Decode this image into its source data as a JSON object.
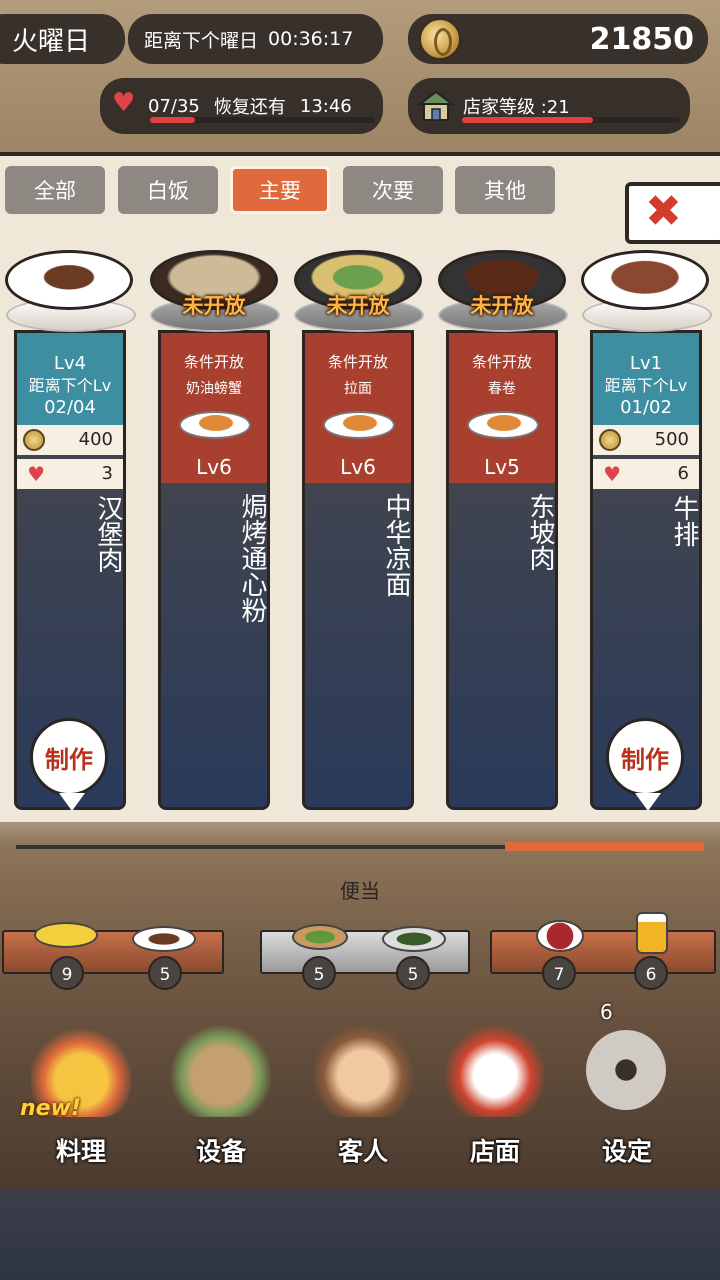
{
  "hud": {
    "day": "火曜日",
    "timer_label": "距离下个曜日",
    "timer_value": "00:36:17",
    "coins": "21850",
    "hearts": "07/35",
    "recover_label": "恢复还有",
    "recover_time": "13:46",
    "hearts_progress": 0.2,
    "shop_label": "店家等级 :21",
    "shop_progress": 0.6
  },
  "tabs": [
    "全部",
    "白饭",
    "主要",
    "次要",
    "其他"
  ],
  "active_tab": "主要",
  "dishes": [
    {
      "name": "汉堡肉",
      "lv": "Lv4",
      "next_label": "距离下个Lv",
      "progress": "02/04",
      "price": "400",
      "hearts": "3",
      "make": "制作"
    },
    {
      "name": "焗烤通心粉",
      "locked": "未开放",
      "cond": "条件开放",
      "cond_dish": "奶油螃蟹",
      "lv": "Lv6"
    },
    {
      "name": "中华凉面",
      "locked": "未开放",
      "cond": "条件开放",
      "cond_dish": "拉面",
      "lv": "Lv6"
    },
    {
      "name": "东坡肉",
      "locked": "未开放",
      "cond": "条件开放",
      "cond_dish": "春卷",
      "lv": "Lv5"
    },
    {
      "name": "牛排",
      "lv": "Lv1",
      "next_label": "距离下个Lv",
      "progress": "01/02",
      "price": "500",
      "hearts": "6",
      "make": "制作"
    }
  ],
  "counter": {
    "title": "便当",
    "counts": [
      "9",
      "5",
      "5",
      "5",
      "7",
      "6"
    ]
  },
  "nav": {
    "items": [
      "料理",
      "设备",
      "客人",
      "店面",
      "设定"
    ],
    "new_badge": "new!",
    "gear_count": "6"
  }
}
